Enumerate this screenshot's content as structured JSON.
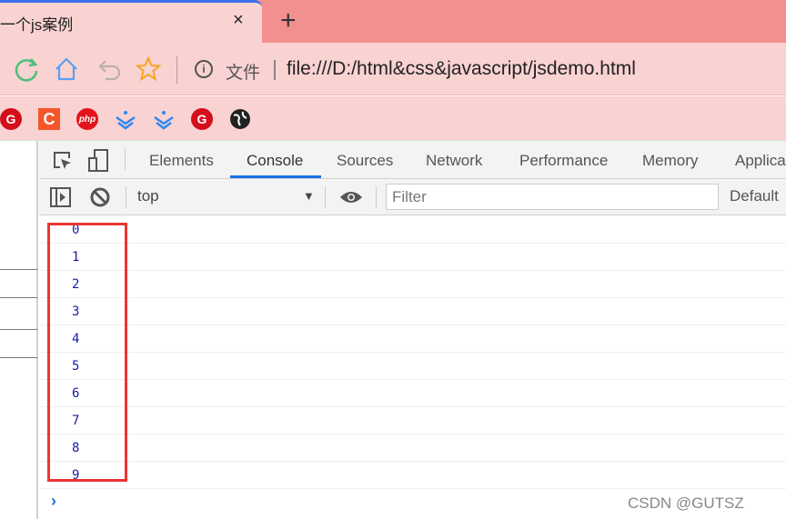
{
  "tab": {
    "title": "一个js案例",
    "close": "×",
    "new_tab": "+"
  },
  "toolbar": {
    "info": "i",
    "file_label": "文件",
    "url": "file:///D:/html&css&javascript/jsdemo.html"
  },
  "bookmarks": [
    {
      "icon": "g-red-icon",
      "text": "G"
    },
    {
      "icon": "c-orange-icon",
      "text": "C"
    },
    {
      "icon": "php-icon",
      "text": "php"
    },
    {
      "icon": "blue-chevrons-icon",
      "text": ""
    },
    {
      "icon": "blue-chevrons-icon",
      "text": ""
    },
    {
      "icon": "g-red-dot-icon",
      "text": "G"
    },
    {
      "icon": "globe-icon",
      "text": ""
    }
  ],
  "devtools": {
    "tabs": [
      "Elements",
      "Console",
      "Sources",
      "Network",
      "Performance",
      "Memory",
      "Applica"
    ],
    "active_tab": "Console",
    "context": "top",
    "filter_placeholder": "Filter",
    "levels": "Default",
    "console_output": [
      "0",
      "1",
      "2",
      "3",
      "4",
      "5",
      "6",
      "7",
      "8",
      "9"
    ],
    "prompt": "›"
  },
  "watermark": "CSDN @GUTSZ",
  "colors": {
    "tab_bg": "#f9d2d2",
    "strip_bg": "#f28f8f",
    "accent": "#1a73e8",
    "highlight_box": "#ee3333",
    "output": "#1a1aa6"
  }
}
